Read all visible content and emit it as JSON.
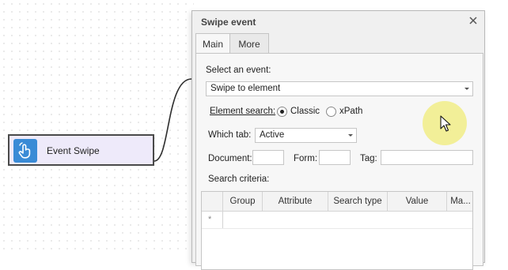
{
  "node": {
    "label": "Event Swipe",
    "icon": "touch-hand-icon"
  },
  "dialog": {
    "title": "Swipe event",
    "tabs": [
      {
        "label": "Main"
      },
      {
        "label": "More"
      }
    ],
    "select_event": {
      "label": "Select an event:",
      "value": "Swipe to element"
    },
    "element_search": {
      "label": "Element search:",
      "options": [
        {
          "label": "Classic",
          "selected": true
        },
        {
          "label": "xPath",
          "selected": false
        }
      ]
    },
    "which_tab": {
      "label": "Which tab:",
      "value": "Active"
    },
    "document_label": "Document:",
    "form_label": "Form:",
    "tag_label": "Tag:",
    "search_criteria": {
      "label": "Search criteria:",
      "columns": [
        "Group",
        "Attribute",
        "Search type",
        "Value",
        "Ma..."
      ],
      "new_row_marker": "*"
    }
  },
  "colors": {
    "node_fill": "#eeeafa",
    "icon_blue": "#3a8bd6",
    "cursor_highlight": "#f0ec78"
  }
}
